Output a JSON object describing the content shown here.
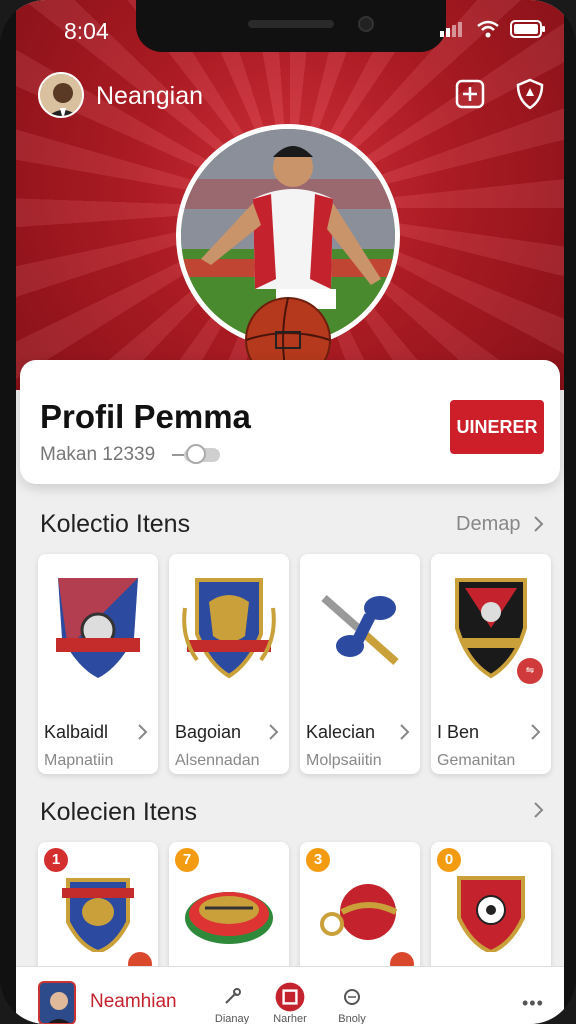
{
  "status": {
    "time": "8:04"
  },
  "header": {
    "user_name": "Neangian"
  },
  "profile": {
    "title": "Profil Pemma",
    "subtitle": "Makan 12339",
    "button_label": "UINERER"
  },
  "section1": {
    "title": "Kolectio Itens",
    "link": "Demap",
    "items": [
      {
        "name": "Kalbaidl",
        "meta": "Mapnatiin"
      },
      {
        "name": "Bagoian",
        "meta": "Alsennadan"
      },
      {
        "name": "Kalecian",
        "meta": "Molpsaiitin"
      },
      {
        "name": "I Ben",
        "meta": "Gemanitan"
      }
    ]
  },
  "section2": {
    "title": "Kolecien Itens",
    "items": [
      {
        "num": "1",
        "color": "#d32f2f"
      },
      {
        "num": "7",
        "color": "#f39c12"
      },
      {
        "num": "3",
        "color": "#f39c12"
      },
      {
        "num": "0",
        "color": "#f39c12"
      }
    ]
  },
  "bottom_nav": {
    "name": "Neamhian",
    "items": [
      {
        "label": "Dianay"
      },
      {
        "label": "Narher"
      },
      {
        "label": "Bnoly"
      }
    ],
    "more": "•••"
  },
  "colors": {
    "brand_red": "#cc1f2a",
    "hero_red": "#b41c25"
  }
}
